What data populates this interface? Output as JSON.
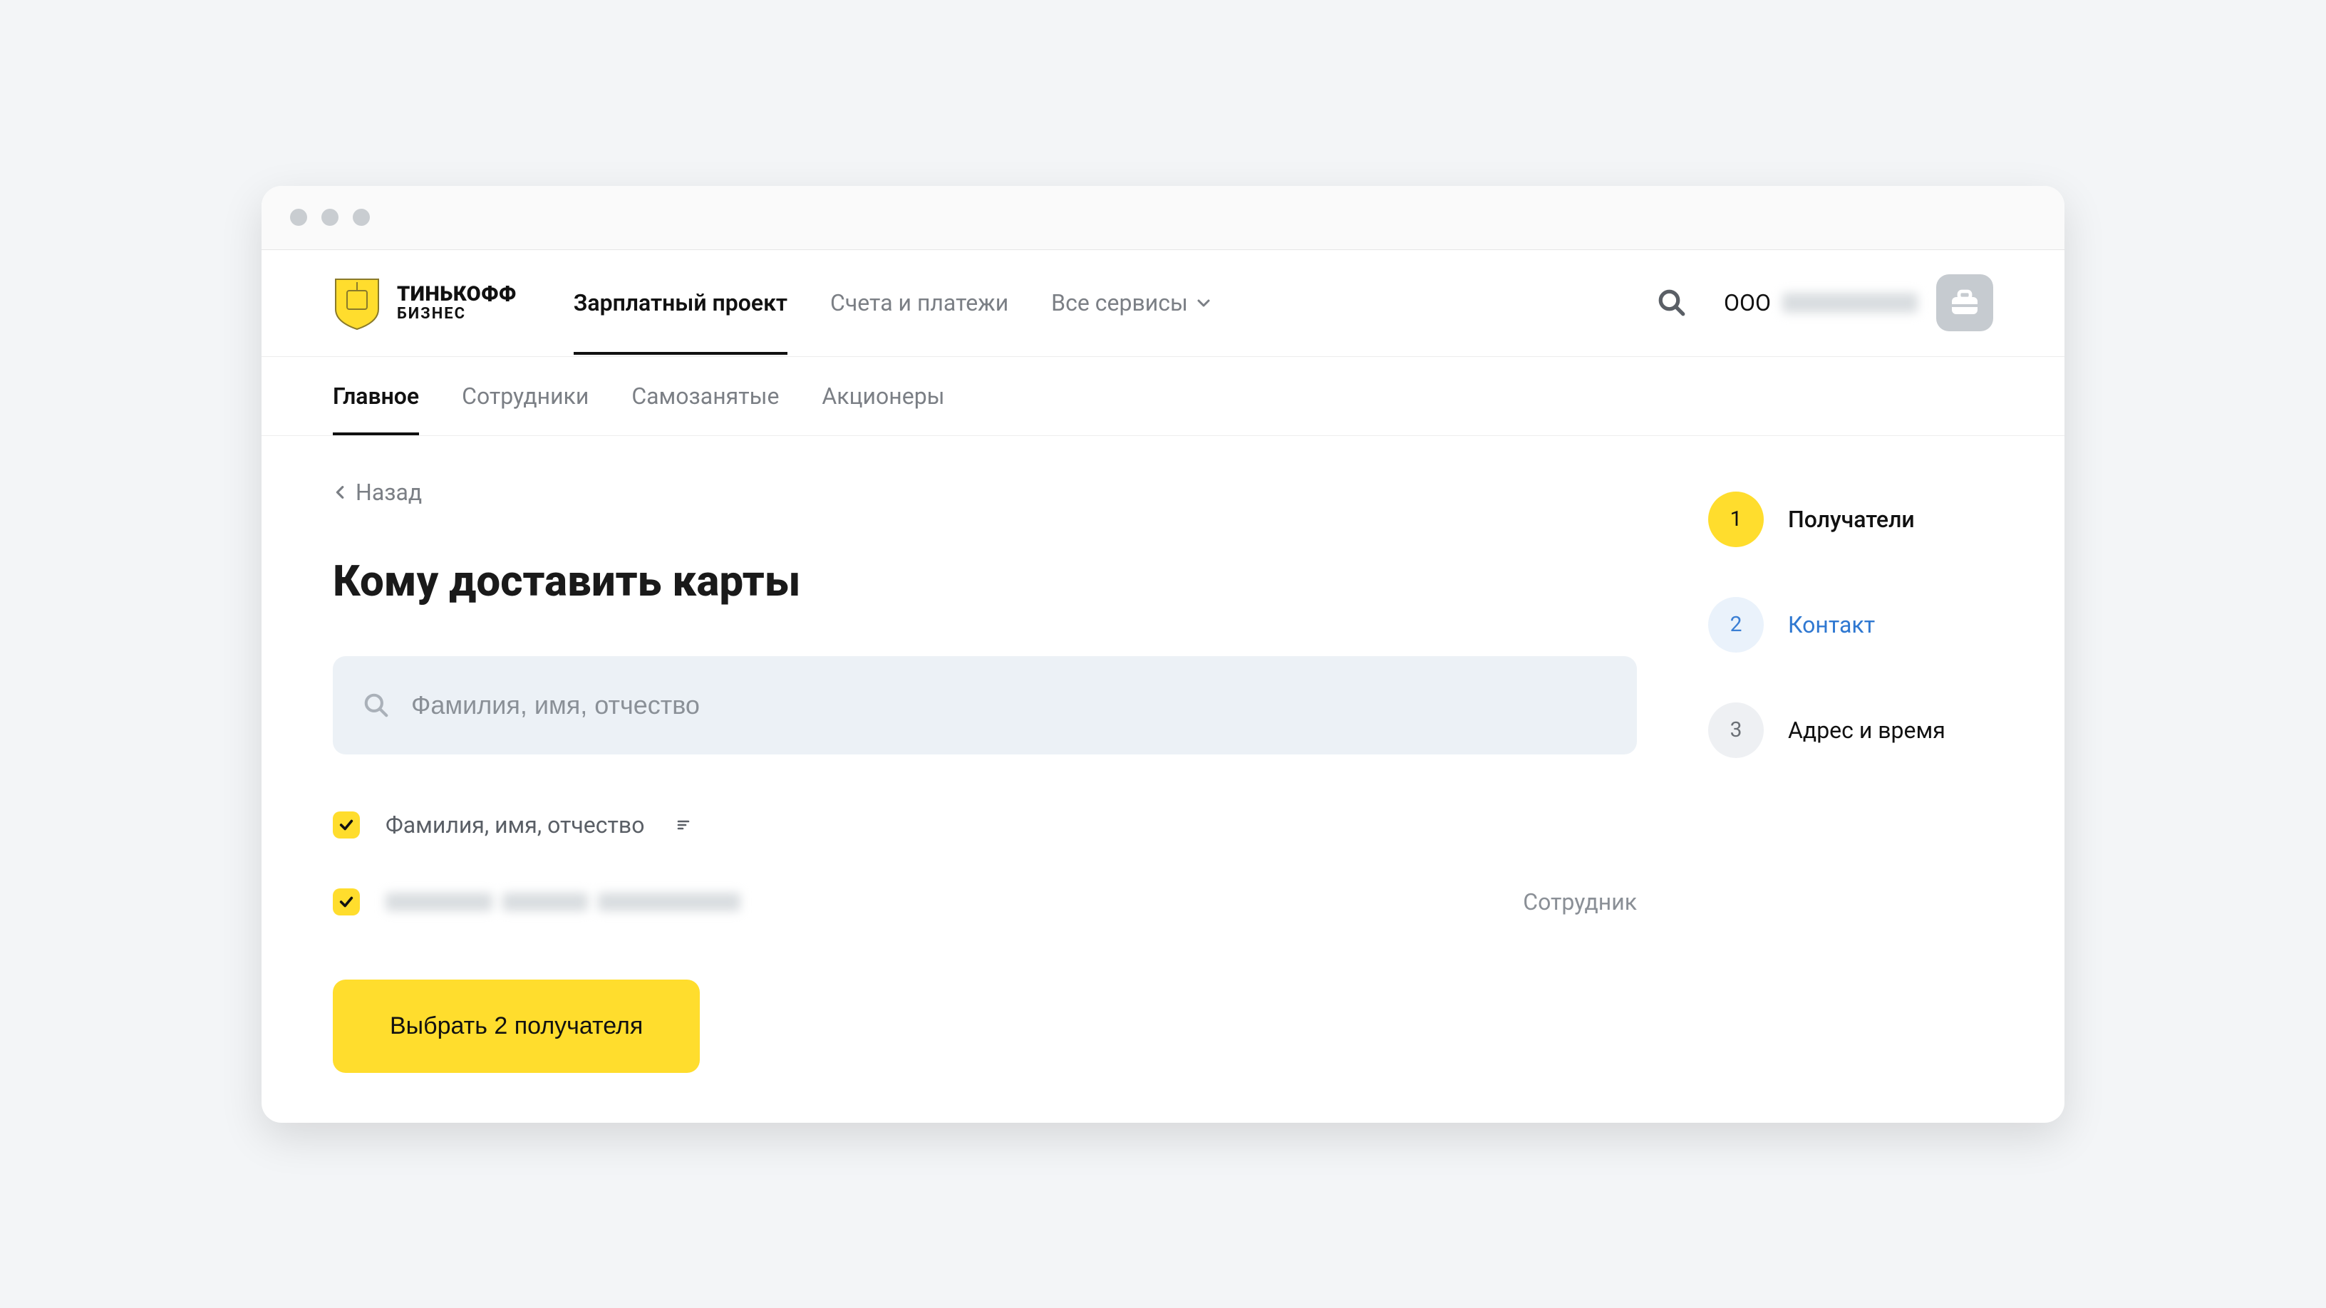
{
  "logo": {
    "line1": "ТИНЬКОФФ",
    "line2": "БИЗНЕС"
  },
  "top_nav": {
    "items": [
      {
        "label": "Зарплатный проект",
        "active": true
      },
      {
        "label": "Счета и платежи",
        "active": false
      },
      {
        "label": "Все сервисы",
        "active": false,
        "dropdown": true
      }
    ]
  },
  "company_prefix": "ООО",
  "sub_nav": {
    "items": [
      {
        "label": "Главное",
        "active": true
      },
      {
        "label": "Сотрудники",
        "active": false
      },
      {
        "label": "Самозанятые",
        "active": false
      },
      {
        "label": "Акционеры",
        "active": false
      }
    ]
  },
  "back_label": "Назад",
  "page_title": "Кому доставить карты",
  "search": {
    "placeholder": "Фамилия, имя, отчество"
  },
  "list": {
    "header_label": "Фамилия, имя, отчество",
    "rows": [
      {
        "role": "Сотрудник",
        "checked": true
      }
    ]
  },
  "primary_button": "Выбрать 2 получателя",
  "steps": [
    {
      "num": "1",
      "label": "Получатели",
      "state": "active"
    },
    {
      "num": "2",
      "label": "Контакт",
      "state": "link"
    },
    {
      "num": "3",
      "label": "Адрес и время",
      "state": "pending"
    }
  ]
}
